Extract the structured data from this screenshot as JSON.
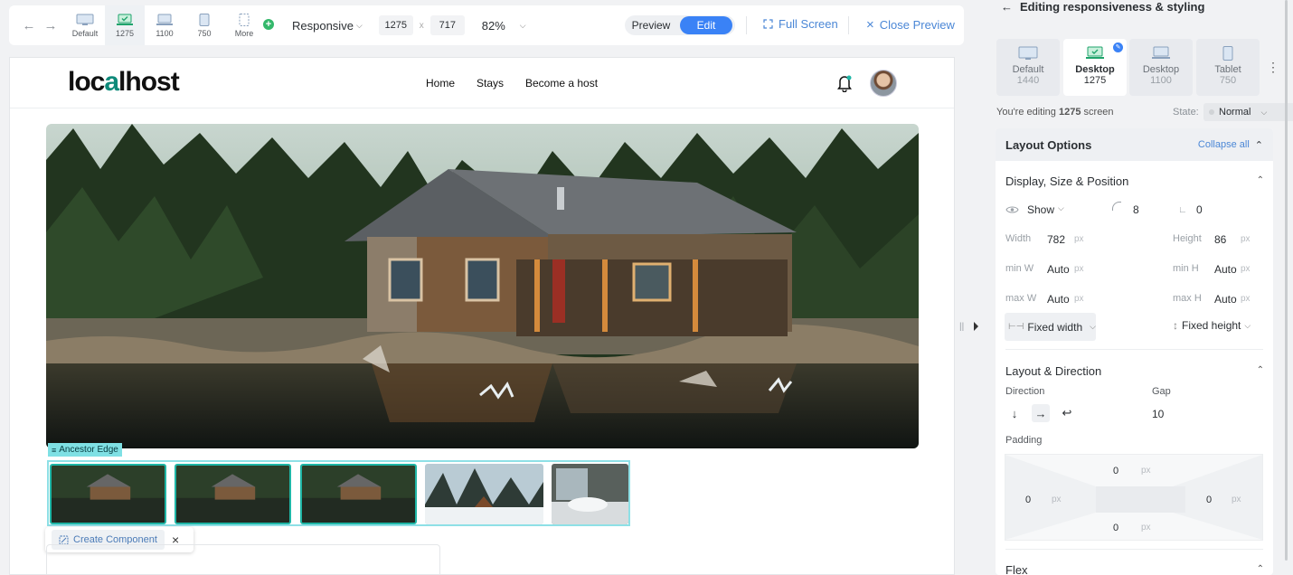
{
  "toolbar": {
    "devices": [
      {
        "label": "Default"
      },
      {
        "label": "1275"
      },
      {
        "label": "1100"
      },
      {
        "label": "750"
      },
      {
        "label": "More"
      }
    ],
    "mode": "Responsive",
    "width": "1275",
    "separator": "x",
    "height": "717",
    "zoom": "82%",
    "preview_label": "Preview",
    "edit_label": "Edit",
    "fullscreen_label": "Full Screen",
    "close_preview_label": "Close Preview"
  },
  "site": {
    "logo_left": "loc",
    "logo_mid": "a",
    "logo_right": "lhost",
    "nav": [
      "Home",
      "Stays",
      "Become a host"
    ]
  },
  "canvas": {
    "ancestor_label": "Ancestor Edge",
    "create_component_label": "Create Component"
  },
  "panel": {
    "title": "Editing responsiveness & styling",
    "tabs": [
      {
        "name": "Default",
        "width": "1440"
      },
      {
        "name": "Desktop",
        "width": "1275"
      },
      {
        "name": "Desktop",
        "width": "1100"
      },
      {
        "name": "Tablet",
        "width": "750"
      }
    ],
    "editing_prefix": "You're editing",
    "editing_width": "1275",
    "editing_suffix": "screen",
    "state_label": "State:",
    "state_value": "Normal",
    "layout_options": "Layout Options",
    "collapse_all": "Collapse all",
    "display_section": "Display, Size & Position",
    "show_label": "Show",
    "radius_value": "8",
    "corner_value": "0",
    "width_label": "Width",
    "width_value": "782",
    "height_label": "Height",
    "height_value": "86",
    "unit": "px",
    "minw_label": "min W",
    "minw_value": "Auto",
    "minh_label": "min H",
    "minh_value": "Auto",
    "maxw_label": "max W",
    "maxw_value": "Auto",
    "maxh_label": "max H",
    "maxh_value": "Auto",
    "fixed_width": "Fixed width",
    "fixed_height": "Fixed height",
    "layout_section": "Layout & Direction",
    "direction_label": "Direction",
    "gap_label": "Gap",
    "gap_value": "10",
    "padding_label": "Padding",
    "pad_top": "0",
    "pad_left": "0",
    "pad_right": "0",
    "pad_bottom": "0",
    "flex_section": "Flex"
  },
  "colors": {
    "accent": "#3a82f6",
    "link": "#4b87d6",
    "selection": "#7fe0e4",
    "brand_green": "#0e8a7a"
  }
}
